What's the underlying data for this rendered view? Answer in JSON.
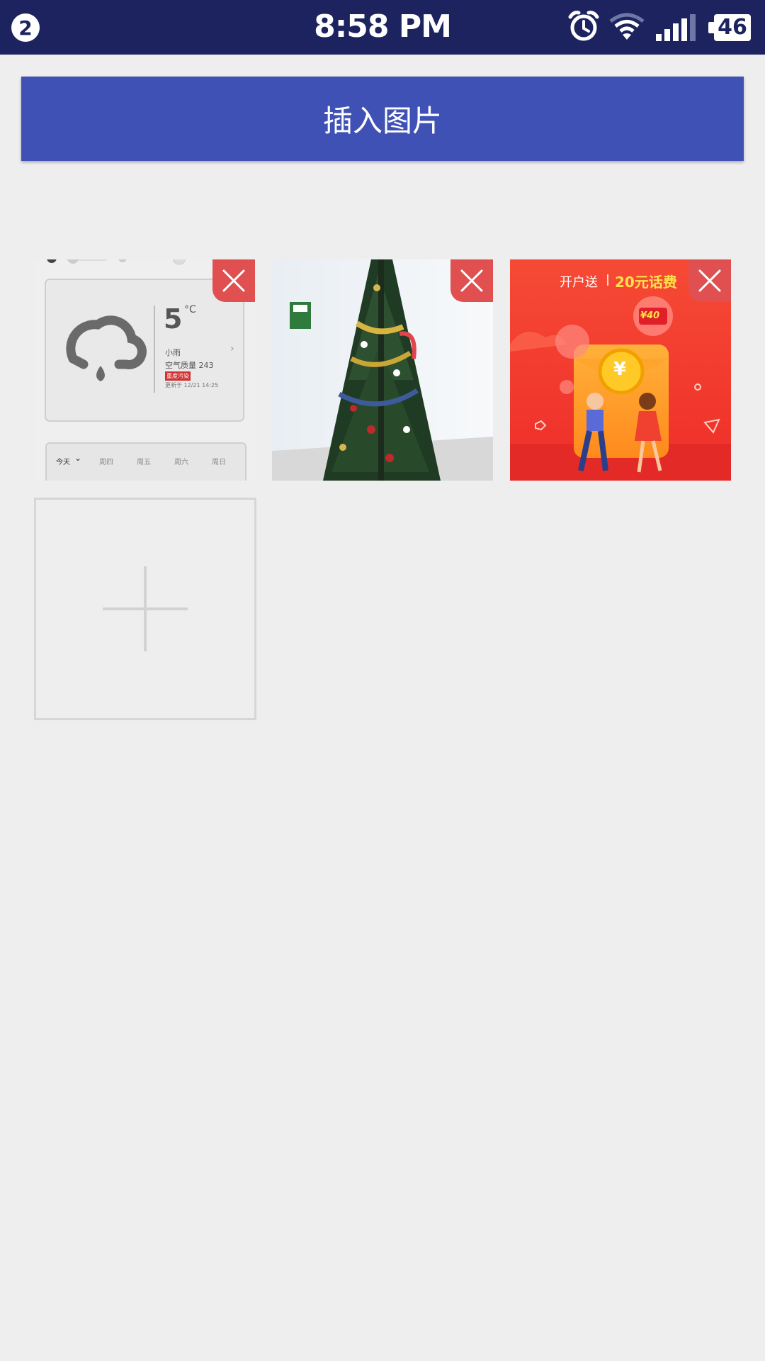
{
  "status_bar": {
    "notification_count": "2",
    "time": "8:58 PM",
    "battery": "46"
  },
  "header": {
    "insert_button_label": "插入图片"
  },
  "images": [
    {
      "name": "weather-screenshot",
      "temperature": "5",
      "unit": "°C",
      "condition": "小雨",
      "air_quality": "空气质量 243",
      "badge": "重度污染",
      "updated": "更新于 12/21 14:25",
      "days": [
        "今天",
        "周四",
        "周五",
        "周六",
        "周日"
      ]
    },
    {
      "name": "christmas-tree-photo"
    },
    {
      "name": "red-envelope-promo",
      "promo_prefix": "开户送",
      "promo_amount": "20元话费",
      "coupon": "¥40",
      "coin": "¥"
    }
  ],
  "colors": {
    "status_bar": "#1c235e",
    "accent": "#3f51b5",
    "delete": "#e05050",
    "background": "#eeeeee"
  }
}
